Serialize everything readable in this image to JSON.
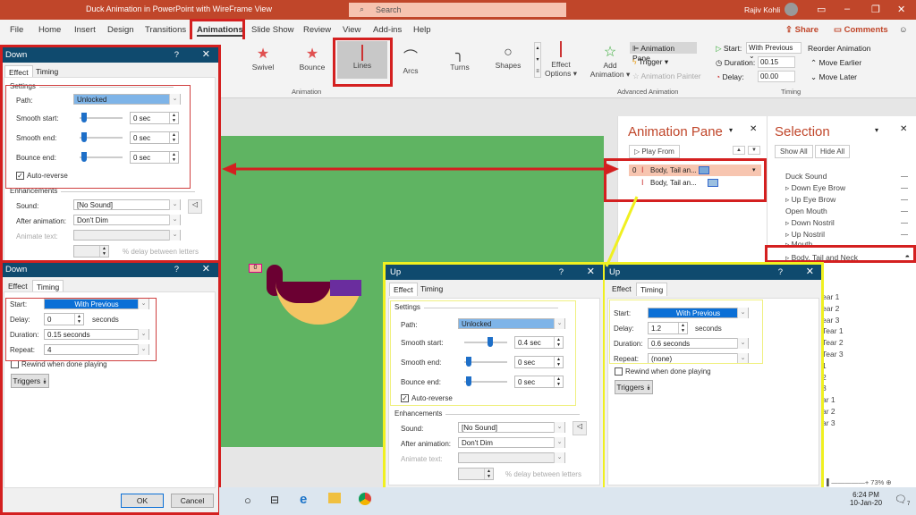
{
  "window": {
    "title": "Duck Animation in PowerPoint with WireFrame View",
    "search_placeholder": "Search",
    "user": "Rajiv Kohli"
  },
  "menu": [
    "File",
    "Home",
    "Insert",
    "Design",
    "Transitions",
    "Animations",
    "Slide Show",
    "Review",
    "View",
    "Add-ins",
    "Help"
  ],
  "menu_active": "Animations",
  "share": "Share",
  "comments": "Comments",
  "ribbon": {
    "effects": [
      "Swivel",
      "Bounce",
      "Lines",
      "Arcs",
      "Turns",
      "Shapes"
    ],
    "selected_effect": "Lines",
    "effect_options": "Effect Options",
    "group_animation": "Animation",
    "add_animation": "Add Animation",
    "animation_pane": "Animation Pane",
    "trigger": "Trigger",
    "animation_painter": "Animation Painter",
    "group_advanced": "Advanced Animation",
    "start_label": "Start:",
    "start_value": "With Previous",
    "duration_label": "Duration:",
    "duration_value": "00.15",
    "delay_label": "Delay:",
    "delay_value": "00.00",
    "reorder": "Reorder Animation",
    "move_earlier": "Move Earlier",
    "move_later": "Move Later",
    "group_timing": "Timing"
  },
  "slide": {
    "tag": "0",
    "bg": "#5fb462"
  },
  "labels": {
    "effect": "Effect",
    "timing": "Timing",
    "settings": "Settings",
    "path": "Path:",
    "smooth_start": "Smooth start:",
    "smooth_end": "Smooth end:",
    "bounce_end": "Bounce end:",
    "auto_reverse": "Auto-reverse",
    "enhancements": "Enhancements",
    "sound": "Sound:",
    "after_animation": "After animation:",
    "animate_text": "Animate text:",
    "delay_letters": "% delay between letters",
    "start": "Start:",
    "delay": "Delay:",
    "duration": "Duration:",
    "repeat": "Repeat:",
    "seconds": "seconds",
    "rewind": "Rewind when done playing",
    "triggers": "Triggers",
    "ok": "OK",
    "cancel": "Cancel"
  },
  "down_effect": {
    "title": "Down",
    "path": "Unlocked",
    "smooth_start": "0 sec",
    "smooth_end": "0 sec",
    "bounce_end": "0 sec",
    "auto_reverse": true,
    "sound": "[No Sound]",
    "after_animation": "Don't Dim",
    "smooth_start_frac": 0,
    "smooth_end_frac": 0,
    "bounce_end_frac": 0
  },
  "down_timing": {
    "title": "Down",
    "start": "With Previous",
    "delay": "0",
    "duration": "0.15 seconds",
    "repeat": "4",
    "rewind": false
  },
  "up_effect": {
    "title": "Up",
    "path": "Unlocked",
    "smooth_start": "0.4 sec",
    "smooth_end": "0 sec",
    "bounce_end": "0 sec",
    "auto_reverse": true,
    "sound": "[No Sound]",
    "after_animation": "Don't Dim"
  },
  "up_timing": {
    "title": "Up",
    "start": "With Previous",
    "delay": "1.2",
    "duration": "0.6 seconds",
    "repeat": "(none)",
    "rewind": false
  },
  "animation_pane": {
    "title": "Animation Pane",
    "play_from": "Play From",
    "items": [
      {
        "num": "0",
        "label": "Body, Tail an..."
      },
      {
        "num": "",
        "label": "Body, Tail an..."
      }
    ]
  },
  "selection_pane": {
    "title": "Selection",
    "show_all": "Show All",
    "hide_all": "Hide All",
    "items": [
      "Duck Sound",
      "Down Eye Brow",
      "Up Eye Brow",
      "Open Mouth",
      "Down Nostril",
      "Up Nostril",
      "Mouth",
      "Body, Tail and Neck"
    ],
    "partial_items": [
      "ear 1",
      "ear 2",
      "ear 3",
      "Tear 1",
      "Tear 2",
      "Tear 3",
      "1",
      "2",
      "3",
      "ar 1",
      "ar 2",
      "ar 3"
    ]
  },
  "status": {
    "zoom": "73%"
  },
  "taskbar": {
    "time": "6:24 PM",
    "date": "10-Jan-20",
    "notifications": "7"
  },
  "colors": {
    "title_bar": "#c0462a",
    "dialog_title": "#0f4a6e",
    "highlight_red": "#d42020",
    "highlight_yellow": "#f0f020"
  }
}
